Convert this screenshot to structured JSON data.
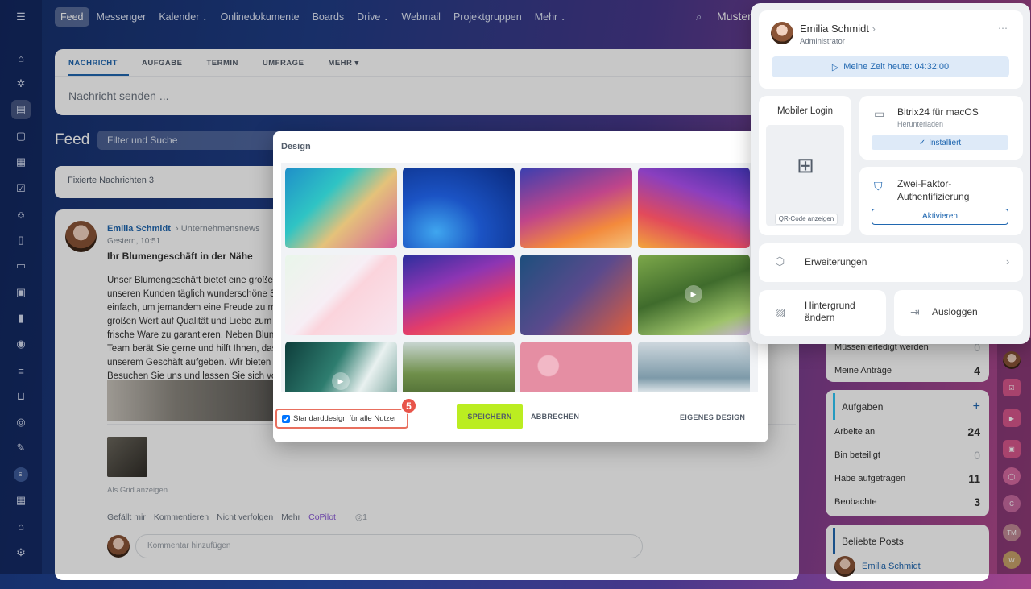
{
  "topnav": {
    "items": [
      "Feed",
      "Messenger",
      "Kalender",
      "Onlinedokumente",
      "Boards",
      "Drive",
      "Webmail",
      "Projektgruppen",
      "Mehr"
    ],
    "user_name": "Muster"
  },
  "post_form": {
    "tabs": [
      "NACHRICHT",
      "AUFGABE",
      "TERMIN",
      "UMFRAGE",
      "MEHR"
    ],
    "placeholder": "Nachricht senden ..."
  },
  "feed": {
    "heading": "Feed",
    "search_placeholder": "Filter und Suche",
    "pinned_label": "Fixierte Nachrichten",
    "pinned_count": "3"
  },
  "post": {
    "author": "Emilia Schmidt",
    "target": "Unternehmensnews",
    "time": "Gestern, 10:51",
    "title": "Ihr Blumengeschäft in der Nähe",
    "lines": [
      "Unser Blumengeschäft bietet eine große",
      "unseren Kunden täglich wunderschöne S",
      "einfach, um jemandem eine Freude zu m",
      "großen Wert auf Qualität und Liebe zum",
      "frische Ware zu garantieren. Neben Blun",
      "Team berät Sie gerne und hilft Ihnen, das",
      "unserem Geschäft aufgeben. Wir bieten",
      "Besuchen Sie uns und lassen Sie sich vo"
    ],
    "grid_label": "Als Grid anzeigen",
    "actions": [
      "Gefällt mir",
      "Kommentieren",
      "Nicht verfolgen",
      "Mehr",
      "CoPilot"
    ],
    "views": "1",
    "comment_placeholder": "Kommentar hinzufügen"
  },
  "right_column": {
    "requests": [
      {
        "label": "Müssen erledigt werden",
        "value": "0"
      },
      {
        "label": "Meine Anträge",
        "value": "4"
      }
    ],
    "tasks_title": "Aufgaben",
    "tasks": [
      {
        "label": "Arbeite an",
        "value": "24"
      },
      {
        "label": "Bin beteiligt",
        "value": "0"
      },
      {
        "label": "Habe aufgetragen",
        "value": "11"
      },
      {
        "label": "Beobachte",
        "value": "3"
      }
    ],
    "popular_title": "Beliebte Posts",
    "popular_author": "Emilia Schmidt"
  },
  "apps_bar": {
    "initials": [
      "C",
      "TM",
      "W"
    ]
  },
  "dialog": {
    "title": "Design",
    "tiles": [
      {
        "bg": "linear-gradient(135deg,#1f8fc9 0%,#2fc4c4 35%,#e4c27a 60%,#d7609b 100%)",
        "video": false
      },
      {
        "bg": "radial-gradient(ellipse at 30% 80%,#3fa6ef 0%,#1b53c4 40%,#0a2a7e 100%)",
        "video": false
      },
      {
        "bg": "linear-gradient(160deg,#3a3fb0 0%,#c0458a 45%,#f38a3c 75%,#f4c27c 100%)",
        "video": false
      },
      {
        "bg": "linear-gradient(200deg,#3b2fa4 0%,#8a3fbf 35%,#e24a5b 70%,#f2a63c 100%)",
        "video": false
      },
      {
        "bg": "linear-gradient(135deg,#e9f6ea 0%,#f7eef5 45%,#fbd4dc 55%,#f8e6f0 100%)",
        "video": false
      },
      {
        "bg": "linear-gradient(160deg,#2b2f9c 0%,#8d35b3 35%,#e23c6a 65%,#f28a4a 100%)",
        "video": false
      },
      {
        "bg": "linear-gradient(135deg,#1d4f7d 0%,#5b4a8d 50%,#e05e3b 100%)",
        "video": false
      },
      {
        "bg": "linear-gradient(160deg,#7da84a 0%,#3f6b2c 45%,#9ec36a 80%,#c9b2dc 100%)",
        "video": true
      },
      {
        "bg": "linear-gradient(120deg,#0e3d3b 0%,#2e7d6f 40%,#e9f1f0 65%,#5a8f86 100%)",
        "video": true
      },
      {
        "bg": "linear-gradient(180deg,#c9d6d3 0%,#6f8f4a 40%,#2f4a1f 100%)",
        "video": false
      },
      {
        "bg": "radial-gradient(circle at 25% 30%,#f2b8c6 0 10%,#e58ea3 11% 100%)",
        "video": false
      },
      {
        "bg": "linear-gradient(180deg,#cfd8de 0%,#7d9aa9 45%,#e9eef1 65%,#6d8796 100%)",
        "video": false
      }
    ],
    "checkbox_label": "Standarddesign für alle Nutzer",
    "badge": "5",
    "save": "SPEICHERN",
    "cancel": "ABBRECHEN",
    "own_design": "EIGENES DESIGN"
  },
  "profile_panel": {
    "name": "Emilia Schmidt",
    "role": "Administrator",
    "time_label": "Meine Zeit heute: 04:32:00",
    "mobile_login_title": "Mobiler Login",
    "qr_link": "QR-Code anzeigen",
    "mac_title": "Bitrix24 für macOS",
    "mac_sub": "Herunterladen",
    "mac_btn": "Installiert",
    "tfa_title": "Zwei-Faktor-Authentifizierung",
    "tfa_btn": "Aktivieren",
    "extensions": "Erweiterungen",
    "background": "Hintergrund ändern",
    "logout": "Ausloggen"
  },
  "colors": {
    "accent": "#2067b0",
    "save_button": "#bbed21",
    "badge": "#e8544a"
  }
}
